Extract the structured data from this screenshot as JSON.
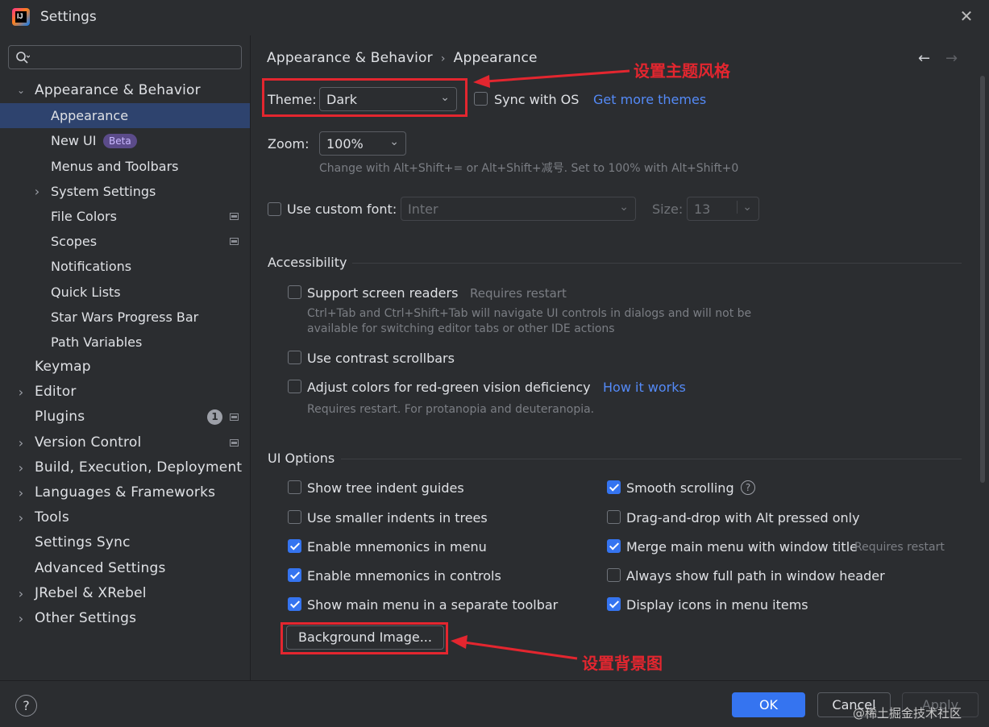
{
  "window": {
    "title": "Settings",
    "close_glyph": "✕",
    "logo_text": "IJ"
  },
  "search": {
    "placeholder": ""
  },
  "sidebar": {
    "items": [
      {
        "label": "Appearance & Behavior",
        "level": 0,
        "expanded": true
      },
      {
        "label": "Appearance",
        "level": 1,
        "selected": true
      },
      {
        "label": "New UI",
        "level": 1,
        "badge": "Beta"
      },
      {
        "label": "Menus and Toolbars",
        "level": 1
      },
      {
        "label": "System Settings",
        "level": 1,
        "collapsed": true
      },
      {
        "label": "File Colors",
        "level": 1,
        "page_icon": true
      },
      {
        "label": "Scopes",
        "level": 1,
        "page_icon": true
      },
      {
        "label": "Notifications",
        "level": 1
      },
      {
        "label": "Quick Lists",
        "level": 1
      },
      {
        "label": "Star Wars Progress Bar",
        "level": 1
      },
      {
        "label": "Path Variables",
        "level": 1
      },
      {
        "label": "Keymap",
        "level": 0
      },
      {
        "label": "Editor",
        "level": 0,
        "collapsed": true
      },
      {
        "label": "Plugins",
        "level": 0,
        "count": "1",
        "page_icon": true
      },
      {
        "label": "Version Control",
        "level": 0,
        "collapsed": true,
        "page_icon": true
      },
      {
        "label": "Build, Execution, Deployment",
        "level": 0,
        "collapsed": true
      },
      {
        "label": "Languages & Frameworks",
        "level": 0,
        "collapsed": true
      },
      {
        "label": "Tools",
        "level": 0,
        "collapsed": true
      },
      {
        "label": "Settings Sync",
        "level": 0
      },
      {
        "label": "Advanced Settings",
        "level": 0
      },
      {
        "label": "JRebel & XRebel",
        "level": 0,
        "collapsed": true
      },
      {
        "label": "Other Settings",
        "level": 0,
        "collapsed": true
      }
    ]
  },
  "breadcrumb": {
    "parent": "Appearance & Behavior",
    "separator": "›",
    "current": "Appearance"
  },
  "nav": {
    "back": "←",
    "forward": "→"
  },
  "theme": {
    "label": "Theme:",
    "value": "Dark",
    "sync_label": "Sync with OS",
    "sync_checked": false,
    "more_link": "Get more themes"
  },
  "zoom": {
    "label": "Zoom:",
    "value": "100%",
    "hint": "Change with Alt+Shift+= or Alt+Shift+减号. Set to 100% with Alt+Shift+0"
  },
  "font": {
    "checkbox_label": "Use custom font:",
    "checked": false,
    "value": "Inter",
    "size_label": "Size:",
    "size_value": "13"
  },
  "accessibility": {
    "title": "Accessibility",
    "screen_readers": {
      "label": "Support screen readers",
      "note": "Requires restart",
      "checked": false,
      "hint_line1": "Ctrl+Tab and Ctrl+Shift+Tab will navigate UI controls in dialogs and will not be",
      "hint_line2": "available for switching editor tabs or other IDE actions"
    },
    "contrast_scrollbars": {
      "label": "Use contrast scrollbars",
      "checked": false
    },
    "color_deficiency": {
      "label": "Adjust colors for red-green vision deficiency",
      "checked": false,
      "link": "How it works",
      "hint": "Requires restart. For protanopia and deuteranopia."
    }
  },
  "ui_options": {
    "title": "UI Options",
    "left": [
      {
        "label": "Show tree indent guides",
        "checked": false
      },
      {
        "label": "Use smaller indents in trees",
        "checked": false
      },
      {
        "label": "Enable mnemonics in menu",
        "checked": true
      },
      {
        "label": "Enable mnemonics in controls",
        "checked": true
      },
      {
        "label": "Show main menu in a separate toolbar",
        "checked": true
      }
    ],
    "right": [
      {
        "label": "Smooth scrolling",
        "checked": true,
        "help": "?"
      },
      {
        "label": "Drag-and-drop with Alt pressed only",
        "checked": false
      },
      {
        "label": "Merge main menu with window title",
        "checked": true,
        "note": "Requires restart"
      },
      {
        "label": "Always show full path in window header",
        "checked": false
      },
      {
        "label": "Display icons in menu items",
        "checked": true
      }
    ],
    "background_button": "Background Image..."
  },
  "annotations": {
    "theme": "设置主题风格",
    "background": "设置背景图",
    "color": "#e3262f"
  },
  "footer": {
    "help": "?",
    "ok": "OK",
    "cancel": "Cancel",
    "apply": "Apply",
    "watermark": "@稀土掘金技术社区"
  },
  "colors": {
    "accent": "#3574f0",
    "link": "#548af7",
    "selection": "#2e436e",
    "background": "#2b2d30"
  }
}
